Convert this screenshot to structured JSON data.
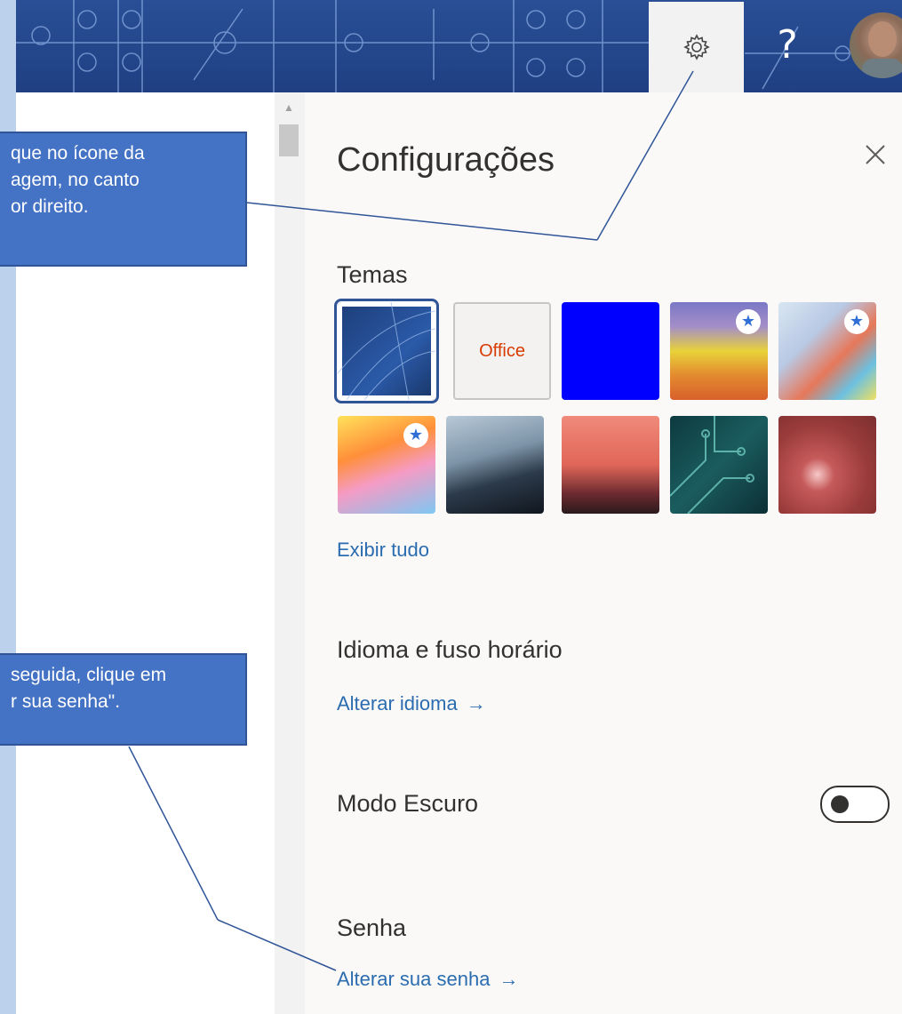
{
  "header": {
    "gear_icon": "gear-icon",
    "help_glyph": "?",
    "avatar": "user-avatar"
  },
  "panel": {
    "title": "Configurações",
    "close_icon": "close-icon",
    "themes": {
      "heading": "Temas",
      "office_tile_label": "Office",
      "show_all": "Exibir tudo"
    },
    "language": {
      "heading": "Idioma e fuso horário",
      "link": "Alterar idioma"
    },
    "dark_mode": {
      "label": "Modo Escuro",
      "enabled": false
    },
    "password": {
      "heading": "Senha",
      "link": "Alterar sua senha"
    }
  },
  "callouts": {
    "gear_instruction": [
      "que no ícone da",
      "agem, no canto",
      "or direito."
    ],
    "password_instruction": [
      "seguida, clique em",
      "r sua senha\"."
    ]
  },
  "colors": {
    "header": "#1f3f82",
    "link": "#2b6cb0",
    "callout_fill": "#4472c4",
    "selected_outline": "#2f5597"
  }
}
